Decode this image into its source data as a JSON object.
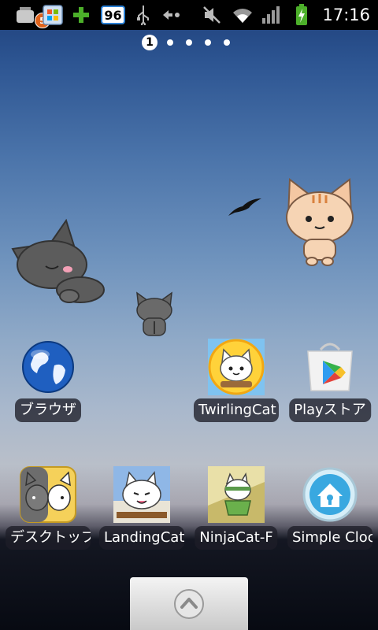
{
  "status_bar": {
    "notification_count": "5",
    "battery_level_indicator": "96",
    "time": "17:16"
  },
  "page_indicator": {
    "current_page": "1",
    "total_pages": 5
  },
  "apps": [
    {
      "label": "ブラウザ",
      "icon": "globe-icon"
    },
    {
      "label": "TwirlingCat",
      "icon": "twirling-cat-icon"
    },
    {
      "label": "Playストア",
      "icon": "play-store-icon"
    },
    {
      "label": "デスクトップ",
      "icon": "desktop-cat-icon"
    },
    {
      "label": "LandingCat",
      "icon": "landing-cat-icon"
    },
    {
      "label": "NinjaCat-F",
      "icon": "ninja-cat-icon"
    },
    {
      "label": "Simple Clock",
      "icon": "home-lock-icon"
    }
  ],
  "colors": {
    "status_bar_bg": "#000000",
    "label_bg": "#1e1e28",
    "accent_green": "#4caf2a"
  }
}
